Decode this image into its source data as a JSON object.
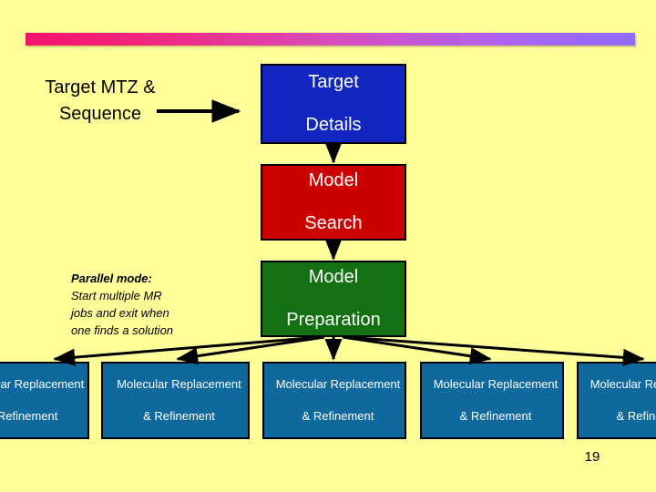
{
  "slide": {
    "page_number": "19",
    "background_color": "#ffff99",
    "accent_bar": {
      "start_color": "#f4136b",
      "end_color": "#8f6cf7"
    }
  },
  "flow": {
    "input_label": "Target MTZ\n&\nSequence",
    "input_label_lines": [
      "Target MTZ",
      "&",
      "Sequence"
    ],
    "stages": [
      {
        "id": "target-details",
        "label": "Target\nDetails",
        "lines": [
          "Target",
          "Details"
        ],
        "color": "#1226c0"
      },
      {
        "id": "model-search",
        "label": "Model\nSearch",
        "lines": [
          "Model",
          "Search"
        ],
        "color": "#cc0000"
      },
      {
        "id": "model-preparation",
        "label": "Model\nPreparation",
        "lines": [
          "Model",
          "Preparation"
        ],
        "color": "#137013"
      }
    ],
    "note": {
      "heading": "Parallel mode:",
      "body": "Start multiple MR jobs and exit when one finds a solution",
      "body_lines": [
        "Start multiple MR",
        "jobs and exit when",
        "one finds a solution"
      ]
    },
    "parallel_jobs": {
      "color": "#10699c",
      "label": "Molecular Replacement\n& Refinement",
      "lines": [
        "Molecular Replacement",
        "& Refinement"
      ],
      "items": [
        {
          "label": "Molecular Replacement & Refinement",
          "line1": "Molecular Replacement",
          "line2": "& Refinement"
        },
        {
          "label": "Molecular Replacement & Refinement",
          "line1": "Molecular Replacement",
          "line2": "& Refinement"
        },
        {
          "label": "Molecular Replacement & Refinement",
          "line1": "Molecular Replacement",
          "line2": "& Refinement"
        },
        {
          "label": "Molecular Replacement & Refinement",
          "line1": "Molecular Replacement",
          "line2": "& Refinement"
        },
        {
          "label": "Molecular Replacement & Refinement",
          "line1": "Molecular Replacement",
          "line2": "& Refinement"
        }
      ]
    }
  }
}
